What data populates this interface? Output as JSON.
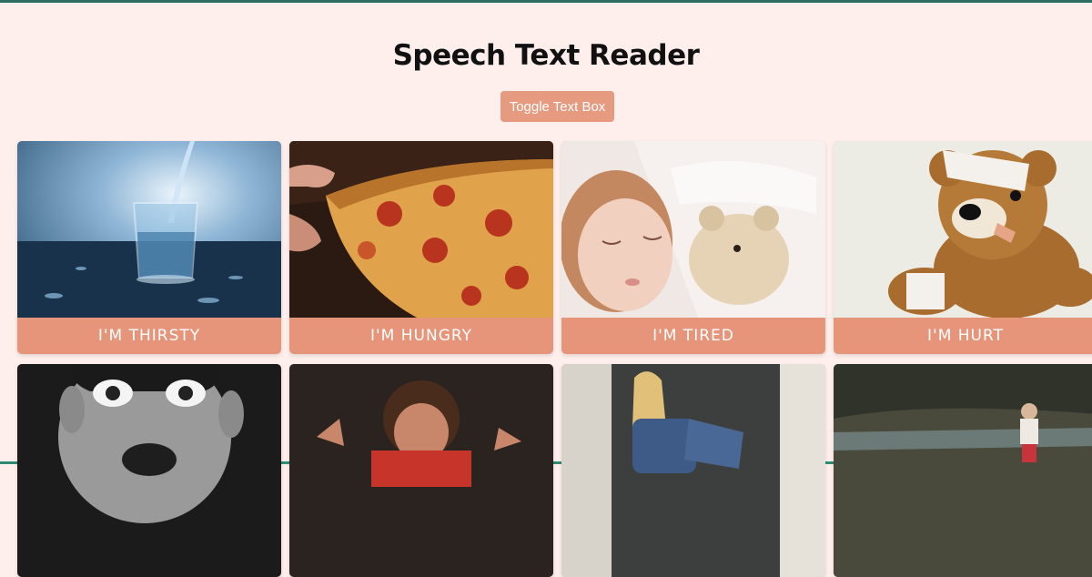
{
  "page": {
    "title": "Speech Text Reader",
    "toggle_label": "Toggle Text Box"
  },
  "cards": [
    {
      "label": "I'M THIRSTY",
      "image": "glass-of-water"
    },
    {
      "label": "I'M HUNGRY",
      "image": "pizza-slice"
    },
    {
      "label": "I'M TIRED",
      "image": "sleeping-child"
    },
    {
      "label": "I'M HURT",
      "image": "bandaged-teddy-bear"
    },
    {
      "label": "",
      "image": "surprised-boy"
    },
    {
      "label": "",
      "image": "angry-boy"
    },
    {
      "label": "",
      "image": "sad-girl-in-doorway"
    },
    {
      "label": "",
      "image": "girl-in-forest"
    }
  ],
  "colors": {
    "background": "#ffefec",
    "accent": "#e6957a",
    "title": "#111111"
  }
}
